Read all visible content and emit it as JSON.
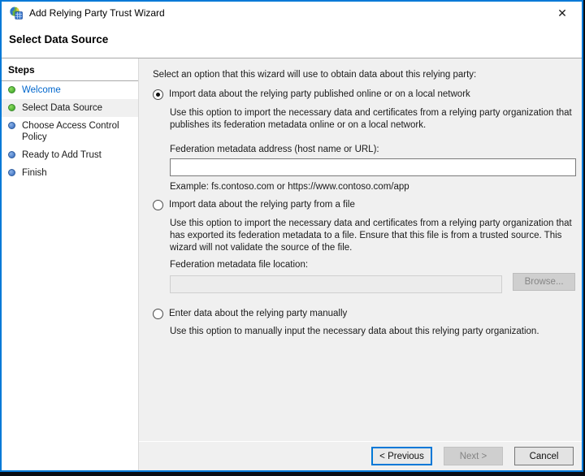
{
  "window": {
    "title": "Add Relying Party Trust Wizard",
    "close_glyph": "✕"
  },
  "header": {
    "title": "Select Data Source"
  },
  "sidebar": {
    "title": "Steps",
    "items": [
      {
        "label": "Welcome",
        "status": "done",
        "current": false
      },
      {
        "label": "Select Data Source",
        "status": "done",
        "current": true
      },
      {
        "label": "Choose Access Control Policy",
        "status": "todo",
        "current": false
      },
      {
        "label": "Ready to Add Trust",
        "status": "todo",
        "current": false
      },
      {
        "label": "Finish",
        "status": "todo",
        "current": false
      }
    ]
  },
  "content": {
    "intro": "Select an option that this wizard will use to obtain data about this relying party:",
    "options": [
      {
        "label": "Import data about the relying party published online or on a local network",
        "selected": true,
        "description": "Use this option to import the necessary data and certificates from a relying party organization that publishes its federation metadata online or on a local network.",
        "field_label": "Federation metadata address (host name or URL):",
        "field_value": "",
        "example": "Example: fs.contoso.com or https://www.contoso.com/app"
      },
      {
        "label": "Import data about the relying party from a file",
        "selected": false,
        "description": "Use this option to import the necessary data and certificates from a relying party organization that has exported its federation metadata to a file. Ensure that this file is from a trusted source.  This wizard will not validate the source of the file.",
        "field_label": "Federation metadata file location:",
        "field_value": "",
        "browse_label": "Browse..."
      },
      {
        "label": "Enter data about the relying party manually",
        "selected": false,
        "description": "Use this option to manually input the necessary data about this relying party organization."
      }
    ]
  },
  "footer": {
    "previous_label": "< Previous",
    "next_label": "Next >",
    "cancel_label": "Cancel"
  },
  "colors": {
    "window_border": "#0079d7",
    "accent": "#0078d7",
    "link": "#0066cc",
    "step_done_bullet": "#3aa42c",
    "step_todo_bullet": "#3a6fc4",
    "content_bg": "#f0f0f0",
    "disabled_text": "#838383"
  }
}
